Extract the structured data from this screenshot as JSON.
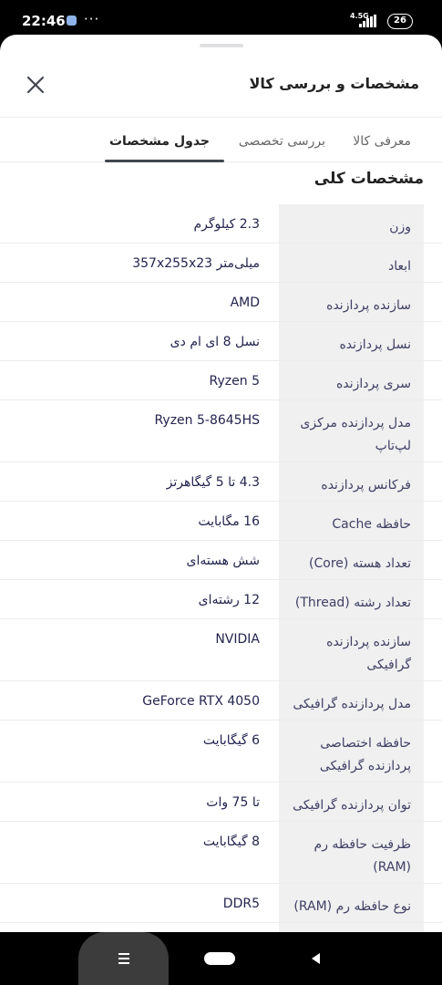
{
  "status_bar": {
    "time": "22:46",
    "dots": "···",
    "network": "4.5G",
    "battery": "26"
  },
  "sheet": {
    "title": "مشخصات و بررسی کالا",
    "tabs": [
      {
        "label": "معرفی کالا",
        "active": false
      },
      {
        "label": "بررسی تخصصی",
        "active": false
      },
      {
        "label": "جدول مشخصات",
        "active": true
      }
    ],
    "section_title": "مشخصات کلی"
  },
  "specs": [
    {
      "label": "وزن",
      "value": "2.3 کیلوگرم"
    },
    {
      "label": "ابعاد",
      "value": "میلی‌متر 357x255x23"
    },
    {
      "label": "سازنده پردازنده",
      "value": "AMD"
    },
    {
      "label": "نسل پردازنده",
      "value": "نسل 8 ای ام دی"
    },
    {
      "label": "سری پردازنده",
      "value": "Ryzen 5"
    },
    {
      "label": "مدل پردازنده مرکزی لپ‌تاپ",
      "value": "Ryzen 5-8645HS"
    },
    {
      "label": "فرکانس پردازنده",
      "value": "4.3 تا 5 گیگاهرتز"
    },
    {
      "label": "حافظه Cache",
      "value": "16 مگابایت"
    },
    {
      "label": "تعداد هسته (Core)",
      "value": "شش هسته‌ای"
    },
    {
      "label": "تعداد رشته (Thread)",
      "value": "12 رشته‌ای"
    },
    {
      "label": "سازنده پردازنده گرافیکی",
      "value": "NVIDIA"
    },
    {
      "label": "مدل پردازنده گرافیکی",
      "value": "GeForce RTX 4050"
    },
    {
      "label": "حافظه اختصاصی پردازنده گرافیکی",
      "value": "6 گیگابایت"
    },
    {
      "label": "توان پردازنده گرافیکی",
      "value": "تا 75 وات"
    },
    {
      "label": "ظرفیت حافظه رم (RAM)",
      "value": "8 گیگابایت"
    },
    {
      "label": "نوع حافظه رم (RAM)",
      "value": "DDR5"
    },
    {
      "label": "",
      "value": ""
    }
  ],
  "icons": {
    "close": "close-icon",
    "menu": "menu-icon",
    "home": "home-pill-icon",
    "back": "back-triangle-icon"
  }
}
